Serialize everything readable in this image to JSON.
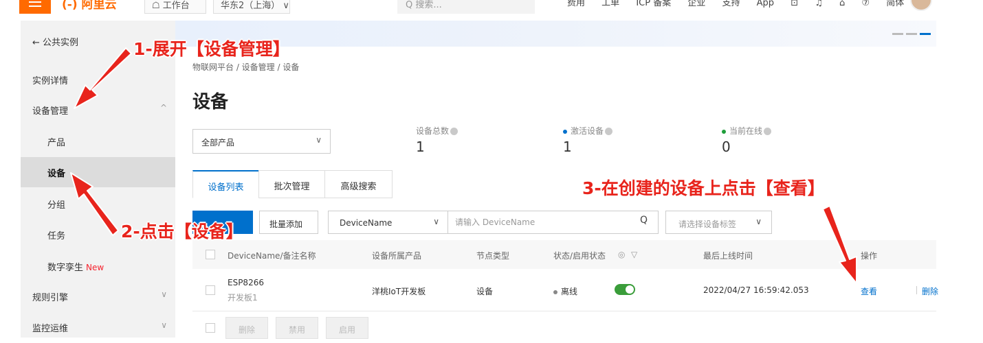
{
  "topbar": {
    "logo_text": "(-) 阿里云",
    "workbench": "☖ 工作台",
    "region": "华东2（上海） ∨",
    "search_placeholder": "Q 搜索...",
    "nav": [
      "费用",
      "工单",
      "ICP 备案",
      "企业",
      "支持",
      "App",
      "⊡",
      "♫",
      "⌂",
      "⑦",
      "简体"
    ]
  },
  "sidebar": {
    "back_label": "← 公共实例",
    "items": [
      {
        "label": "实例详情"
      },
      {
        "label": "设备管理",
        "chevron": "^"
      },
      {
        "label": "产品"
      },
      {
        "label": "设备"
      },
      {
        "label": "分组"
      },
      {
        "label": "任务"
      },
      {
        "label": "数字孪生",
        "badge": "New"
      },
      {
        "label": "规则引擎",
        "chevron": "∨"
      },
      {
        "label": "监控运维",
        "chevron": "∨"
      }
    ]
  },
  "main": {
    "breadcrumb": "物联网平台 / 设备管理 / 设备",
    "title": "设备",
    "product_select": "全部产品",
    "stats": [
      {
        "label": "设备总数",
        "value": "1",
        "dot_color": ""
      },
      {
        "label": "激活设备",
        "value": "1",
        "dot_color": "#0070cc"
      },
      {
        "label": "当前在线",
        "value": "0",
        "dot_color": "#1e9e3a"
      }
    ],
    "tabs": [
      "设备列表",
      "批次管理",
      "高级搜索"
    ],
    "toolbar": {
      "add_button": "",
      "batch_add_button": "批量添加",
      "field_select": "DeviceName",
      "search_placeholder": "请输入 DeviceName",
      "tag_select": "请选择设备标签"
    },
    "table": {
      "headers": [
        "DeviceName/备注名称",
        "设备所属产品",
        "节点类型",
        "状态/启用状态",
        "最后上线时间",
        "操作"
      ],
      "rows": [
        {
          "device_name": "ESP8266",
          "note": "开发板1",
          "product": "洋桃IoT开发板",
          "node_type": "设备",
          "status": "离线",
          "enabled": true,
          "last_online": "2022/04/27 16:59:42.053",
          "actions": [
            "查看",
            "删除"
          ]
        }
      ]
    },
    "bulk_actions": [
      "删除",
      "禁用",
      "启用"
    ]
  },
  "annotations": {
    "step1": "1-展开【设备管理】",
    "step2": "2-点击【设备】",
    "step3": "3-在创建的设备上点击【查看】"
  },
  "colors": {
    "brand": "#ff6a00",
    "primary": "#0070cc",
    "annotation": "#e8241c",
    "toggle_on": "#3a9d3a"
  }
}
